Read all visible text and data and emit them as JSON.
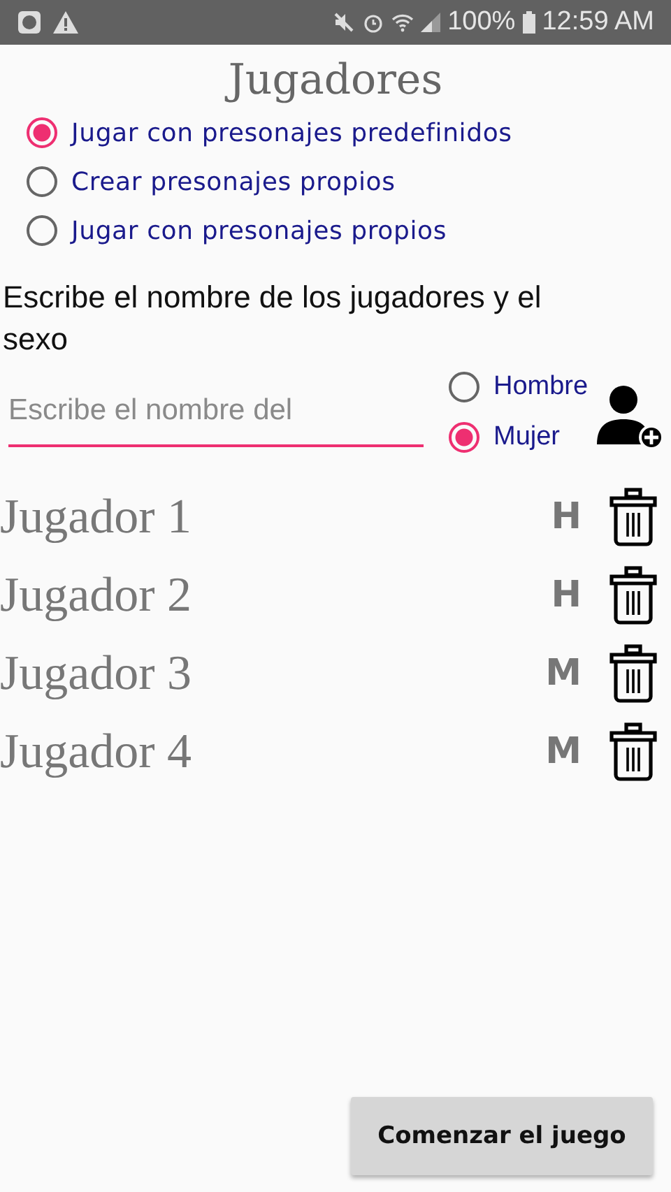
{
  "status_bar": {
    "battery": "100%",
    "time": "12:59 AM"
  },
  "title": "Jugadores",
  "modes": [
    {
      "label": "Jugar con presonajes predefinidos",
      "selected": true
    },
    {
      "label": "Crear presonajes propios",
      "selected": false
    },
    {
      "label": "Jugar con presonajes propios",
      "selected": false
    }
  ],
  "instructions": "Escribe el nombre de los jugadores y el sexo",
  "name_field": {
    "placeholder": "Escribe el nombre del"
  },
  "sex_options": [
    {
      "label": "Hombre",
      "selected": false
    },
    {
      "label": "Mujer",
      "selected": true
    }
  ],
  "players": [
    {
      "name": "Jugador 1",
      "sex": "H"
    },
    {
      "name": "Jugador 2",
      "sex": "H"
    },
    {
      "name": "Jugador 3",
      "sex": "M"
    },
    {
      "name": "Jugador 4",
      "sex": "M"
    }
  ],
  "start_button": "Comenzar el juego"
}
